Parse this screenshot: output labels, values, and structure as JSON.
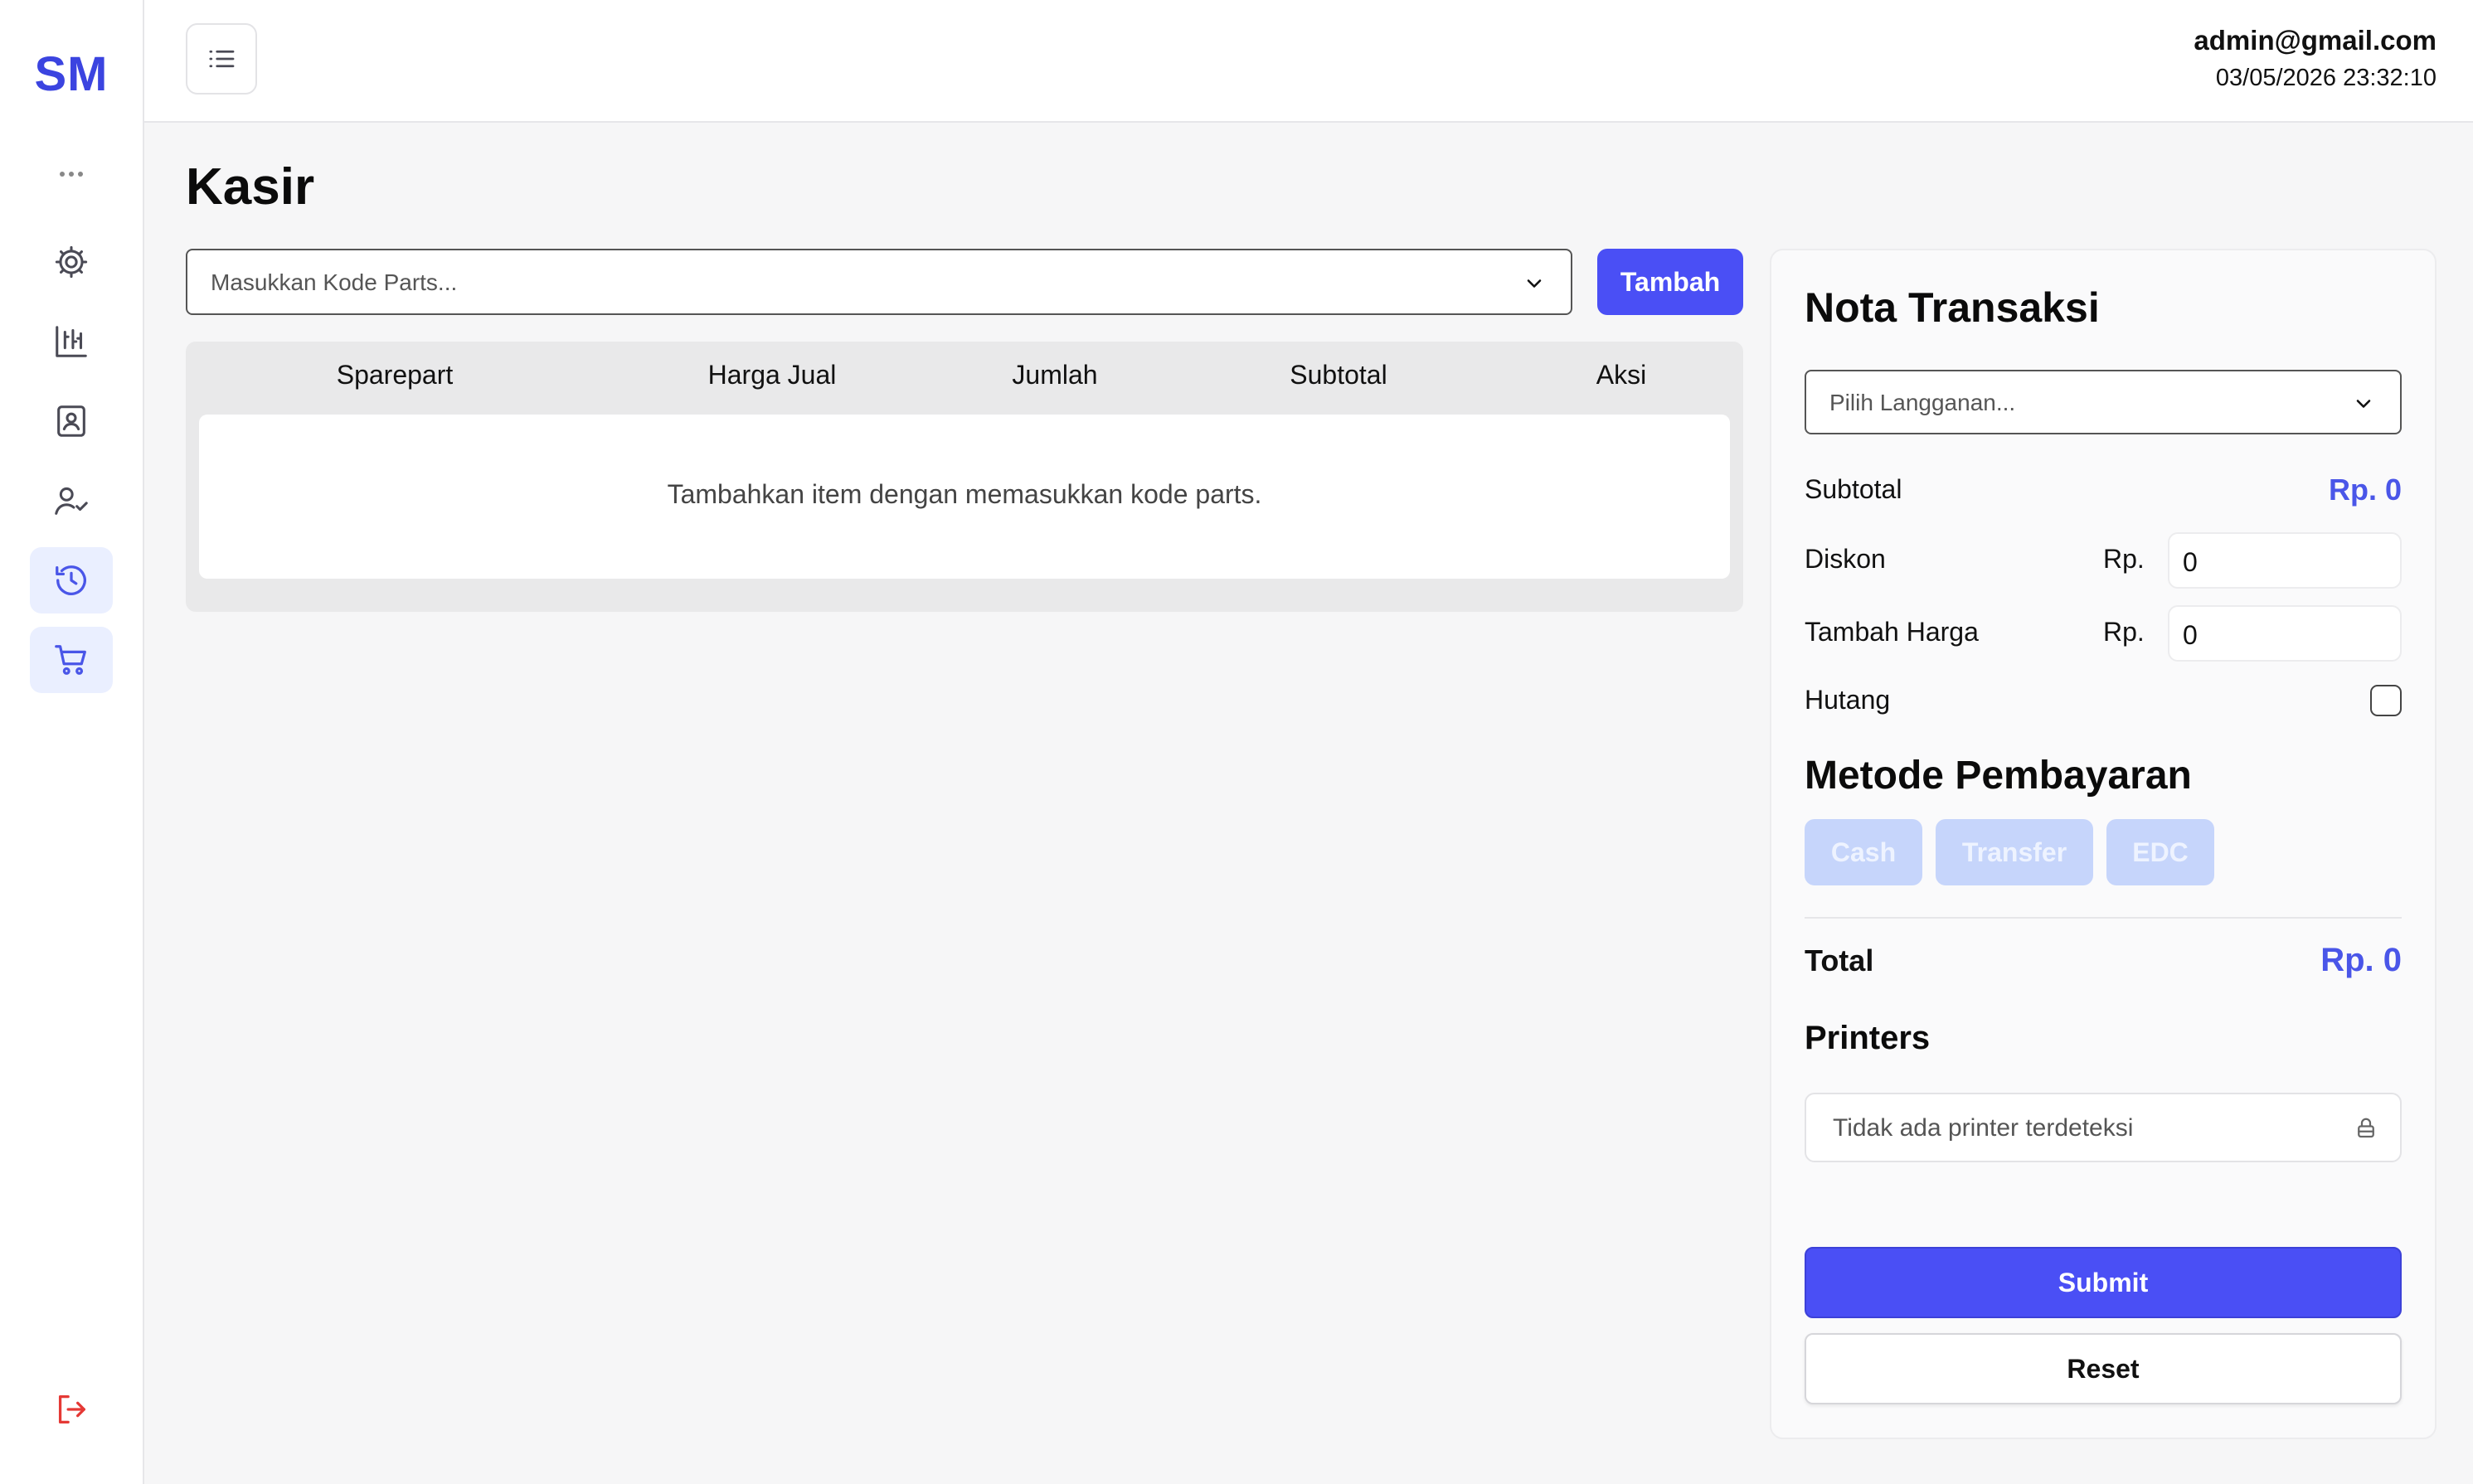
{
  "brand": {
    "logo_text": "SM",
    "accent_color": "#4a4ff5"
  },
  "sidebar": {
    "items": [
      {
        "icon": "more-dots-icon"
      },
      {
        "icon": "gear-icon"
      },
      {
        "icon": "chart-icon"
      },
      {
        "icon": "contact-book-icon"
      },
      {
        "icon": "user-check-icon"
      },
      {
        "icon": "history-icon",
        "active": true
      },
      {
        "icon": "cart-icon",
        "active": true
      }
    ],
    "logout_icon": "logout-icon"
  },
  "header": {
    "menu_icon": "list-icon",
    "user_email": "admin@gmail.com",
    "datetime": "03/05/2026 23:32:10"
  },
  "page": {
    "title": "Kasir"
  },
  "parts": {
    "placeholder": "Masukkan Kode Parts...",
    "add_label": "Tambah"
  },
  "table": {
    "columns": [
      "Sparepart",
      "Harga Jual",
      "Jumlah",
      "Subtotal",
      "Aksi"
    ],
    "empty_message": "Tambahkan item dengan memasukkan kode parts."
  },
  "nota": {
    "title": "Nota Transaksi",
    "customer_placeholder": "Pilih Langganan...",
    "subtotal_label": "Subtotal",
    "subtotal_value": "Rp. 0",
    "diskon_label": "Diskon",
    "diskon_currency": "Rp.",
    "diskon_value": "0",
    "tambah_harga_label": "Tambah Harga",
    "tambah_harga_currency": "Rp.",
    "tambah_harga_value": "0",
    "hutang_label": "Hutang",
    "hutang_checked": false,
    "payment_title": "Metode Pembayaran",
    "payment_methods": [
      "Cash",
      "Transfer",
      "EDC"
    ],
    "total_label": "Total",
    "total_value": "Rp. 0",
    "printers_title": "Printers",
    "printer_placeholder": "Tidak ada printer terdeteksi",
    "submit_label": "Submit",
    "reset_label": "Reset"
  }
}
